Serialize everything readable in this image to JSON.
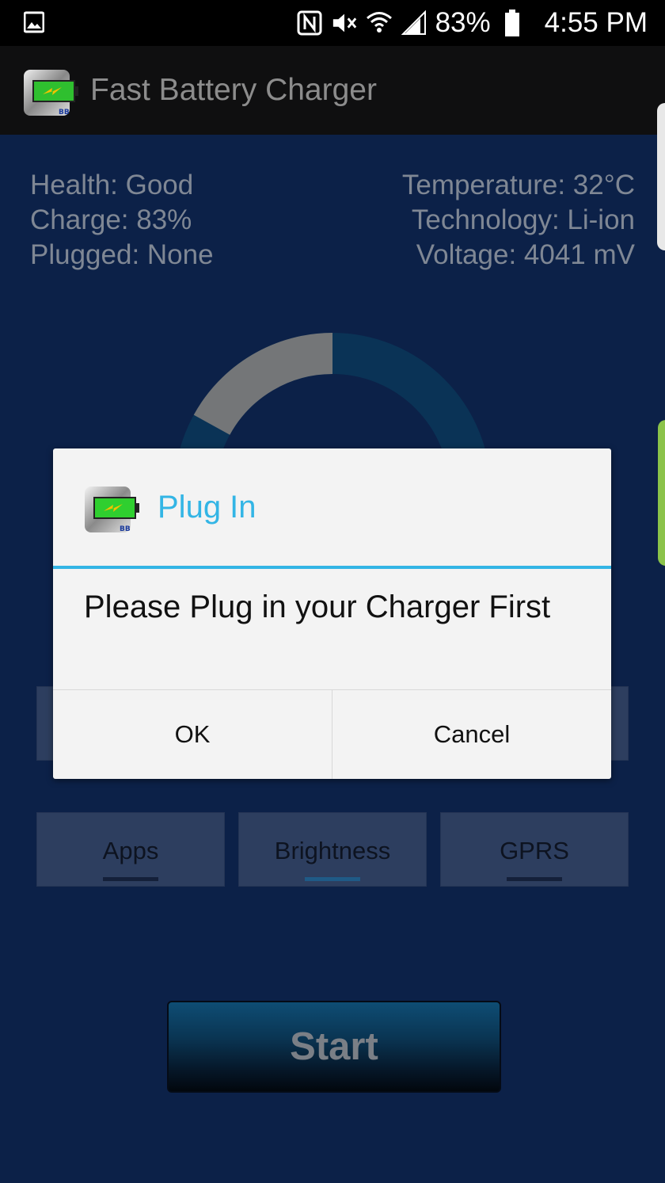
{
  "status_bar": {
    "battery_percent": "83%",
    "time": "4:55 PM",
    "icons": [
      "gallery-icon",
      "nfc-icon",
      "mute-icon",
      "wifi-icon",
      "signal-icon",
      "battery-icon"
    ]
  },
  "app": {
    "title": "Fast Battery Charger",
    "icon": "battery-charger-icon"
  },
  "battery_info": {
    "health": "Health: Good",
    "charge": "Charge: 83%",
    "plugged": "Plugged: None",
    "temperature": "Temperature: 32°C",
    "technology": "Technology: Li-ion",
    "voltage": "Voltage: 4041 mV"
  },
  "gauge": {
    "charge_level": 0.83
  },
  "toggles": {
    "apps": "Apps",
    "brightness": "Brightness",
    "gprs": "GPRS"
  },
  "start_label": "Start",
  "dialog": {
    "title": "Plug In",
    "message": "Please Plug in your Charger First",
    "ok_label": "OK",
    "cancel_label": "Cancel"
  },
  "colors": {
    "background": "#0c2148",
    "accent": "#33b5e5",
    "side_tab_green": "#8bc34a"
  }
}
